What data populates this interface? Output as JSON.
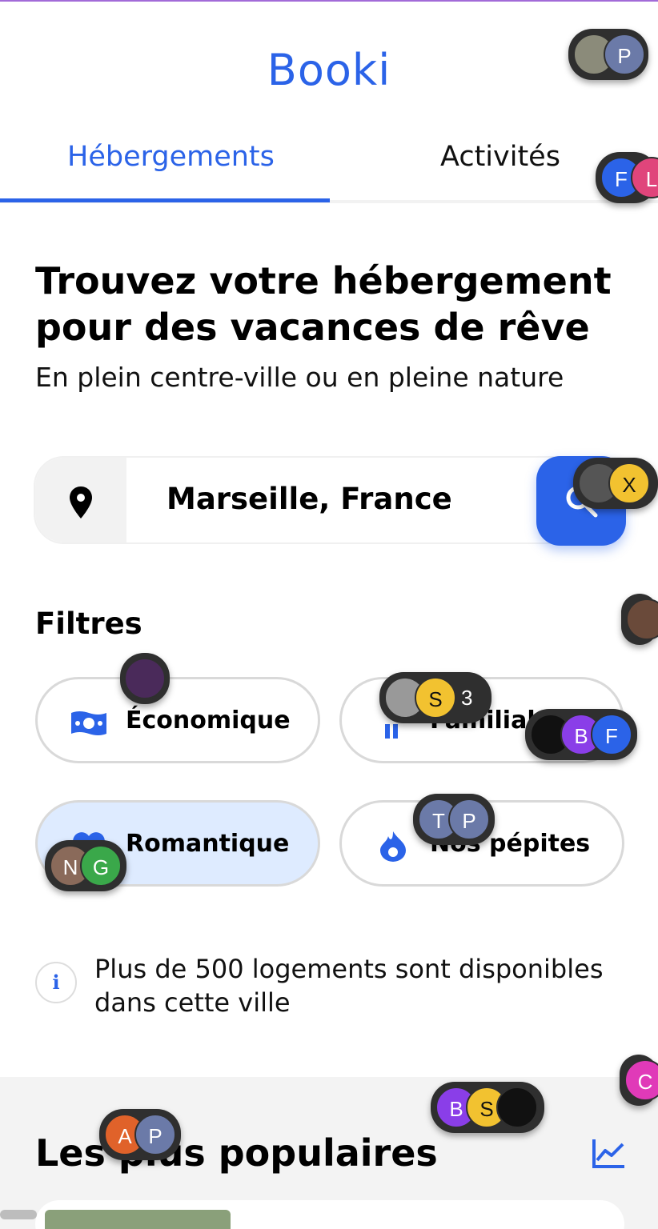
{
  "app": {
    "logo": "Booki"
  },
  "tabs": [
    {
      "label": "Hébergements",
      "active": true
    },
    {
      "label": "Activités",
      "active": false
    }
  ],
  "hero": {
    "title": "Trouvez votre hébergement pour des vacances de rêve",
    "subtitle": "En plein centre-ville ou en pleine nature"
  },
  "search": {
    "value": "Marseille, France",
    "icon": "map-pin-icon",
    "button_icon": "search-icon"
  },
  "filters": {
    "title": "Filtres",
    "items": [
      {
        "label": "Économique",
        "icon": "money-icon",
        "active": false
      },
      {
        "label": "Familial",
        "icon": "family-icon",
        "active": false
      },
      {
        "label": "Romantique",
        "icon": "heart-icon",
        "active": true
      },
      {
        "label": "Nos pépites",
        "icon": "fire-icon",
        "active": false
      }
    ]
  },
  "info": {
    "icon": "info-icon",
    "text": "Plus de 500 logements sont disponibles dans cette ville"
  },
  "popular": {
    "title": "Les plus populaires",
    "icon": "trending-icon"
  },
  "colors": {
    "accent": "#2b63e8",
    "chip_active": "#deebff",
    "section_bg": "#f3f3f3"
  },
  "avatars": {
    "p1": [
      "P"
    ],
    "p2": [
      "F",
      "L"
    ],
    "p3": [
      "X"
    ],
    "p4": [
      "S",
      "3"
    ],
    "p5": [
      "B",
      "F"
    ],
    "p6": [
      "T",
      "P"
    ],
    "p7": [
      "N",
      "G"
    ],
    "p8": [
      "B",
      "S"
    ],
    "p9": [
      "A",
      "P"
    ],
    "p10": [
      "C"
    ]
  }
}
